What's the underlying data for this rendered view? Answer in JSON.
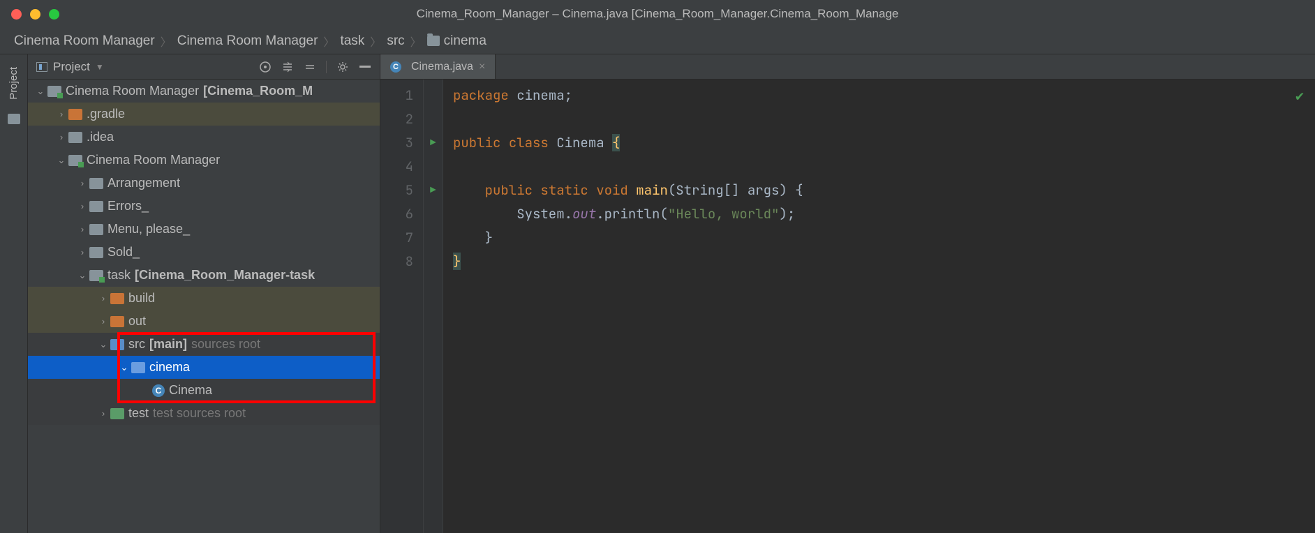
{
  "windowTitle": "Cinema_Room_Manager – Cinema.java [Cinema_Room_Manager.Cinema_Room_Manage",
  "breadcrumbs": [
    "Cinema Room Manager",
    "Cinema Room Manager",
    "task",
    "src",
    "cinema"
  ],
  "projectTab": "Project",
  "panelTitle": "Project",
  "tree": {
    "root": "Cinema Room Manager",
    "rootHint": "[Cinema_Room_M",
    "gradle": ".gradle",
    "idea": ".idea",
    "module": "Cinema Room Manager",
    "arrangement": "Arrangement",
    "errors": "Errors_",
    "menu": "Menu, please_",
    "sold": "Sold_",
    "task": "task",
    "taskHint": "[Cinema_Room_Manager-task",
    "build": "build",
    "out": "out",
    "src": "src",
    "srcBold": "[main]",
    "srcHint": "sources root",
    "cinema": "cinema",
    "class": "Cinema",
    "test": "test",
    "testHint": "test sources root"
  },
  "editorTab": "Cinema.java",
  "lineNumbers": [
    "1",
    "2",
    "3",
    "4",
    "5",
    "6",
    "7",
    "8"
  ],
  "code": {
    "package": "package",
    "packageName": "cinema",
    "public": "public",
    "class": "class",
    "className": "Cinema",
    "static": "static",
    "void": "void",
    "main": "main",
    "args": "(String[] args) {",
    "system": "System.",
    "out": "out",
    "println": ".println(",
    "hello": "\"Hello, world\"",
    "close": ");"
  }
}
